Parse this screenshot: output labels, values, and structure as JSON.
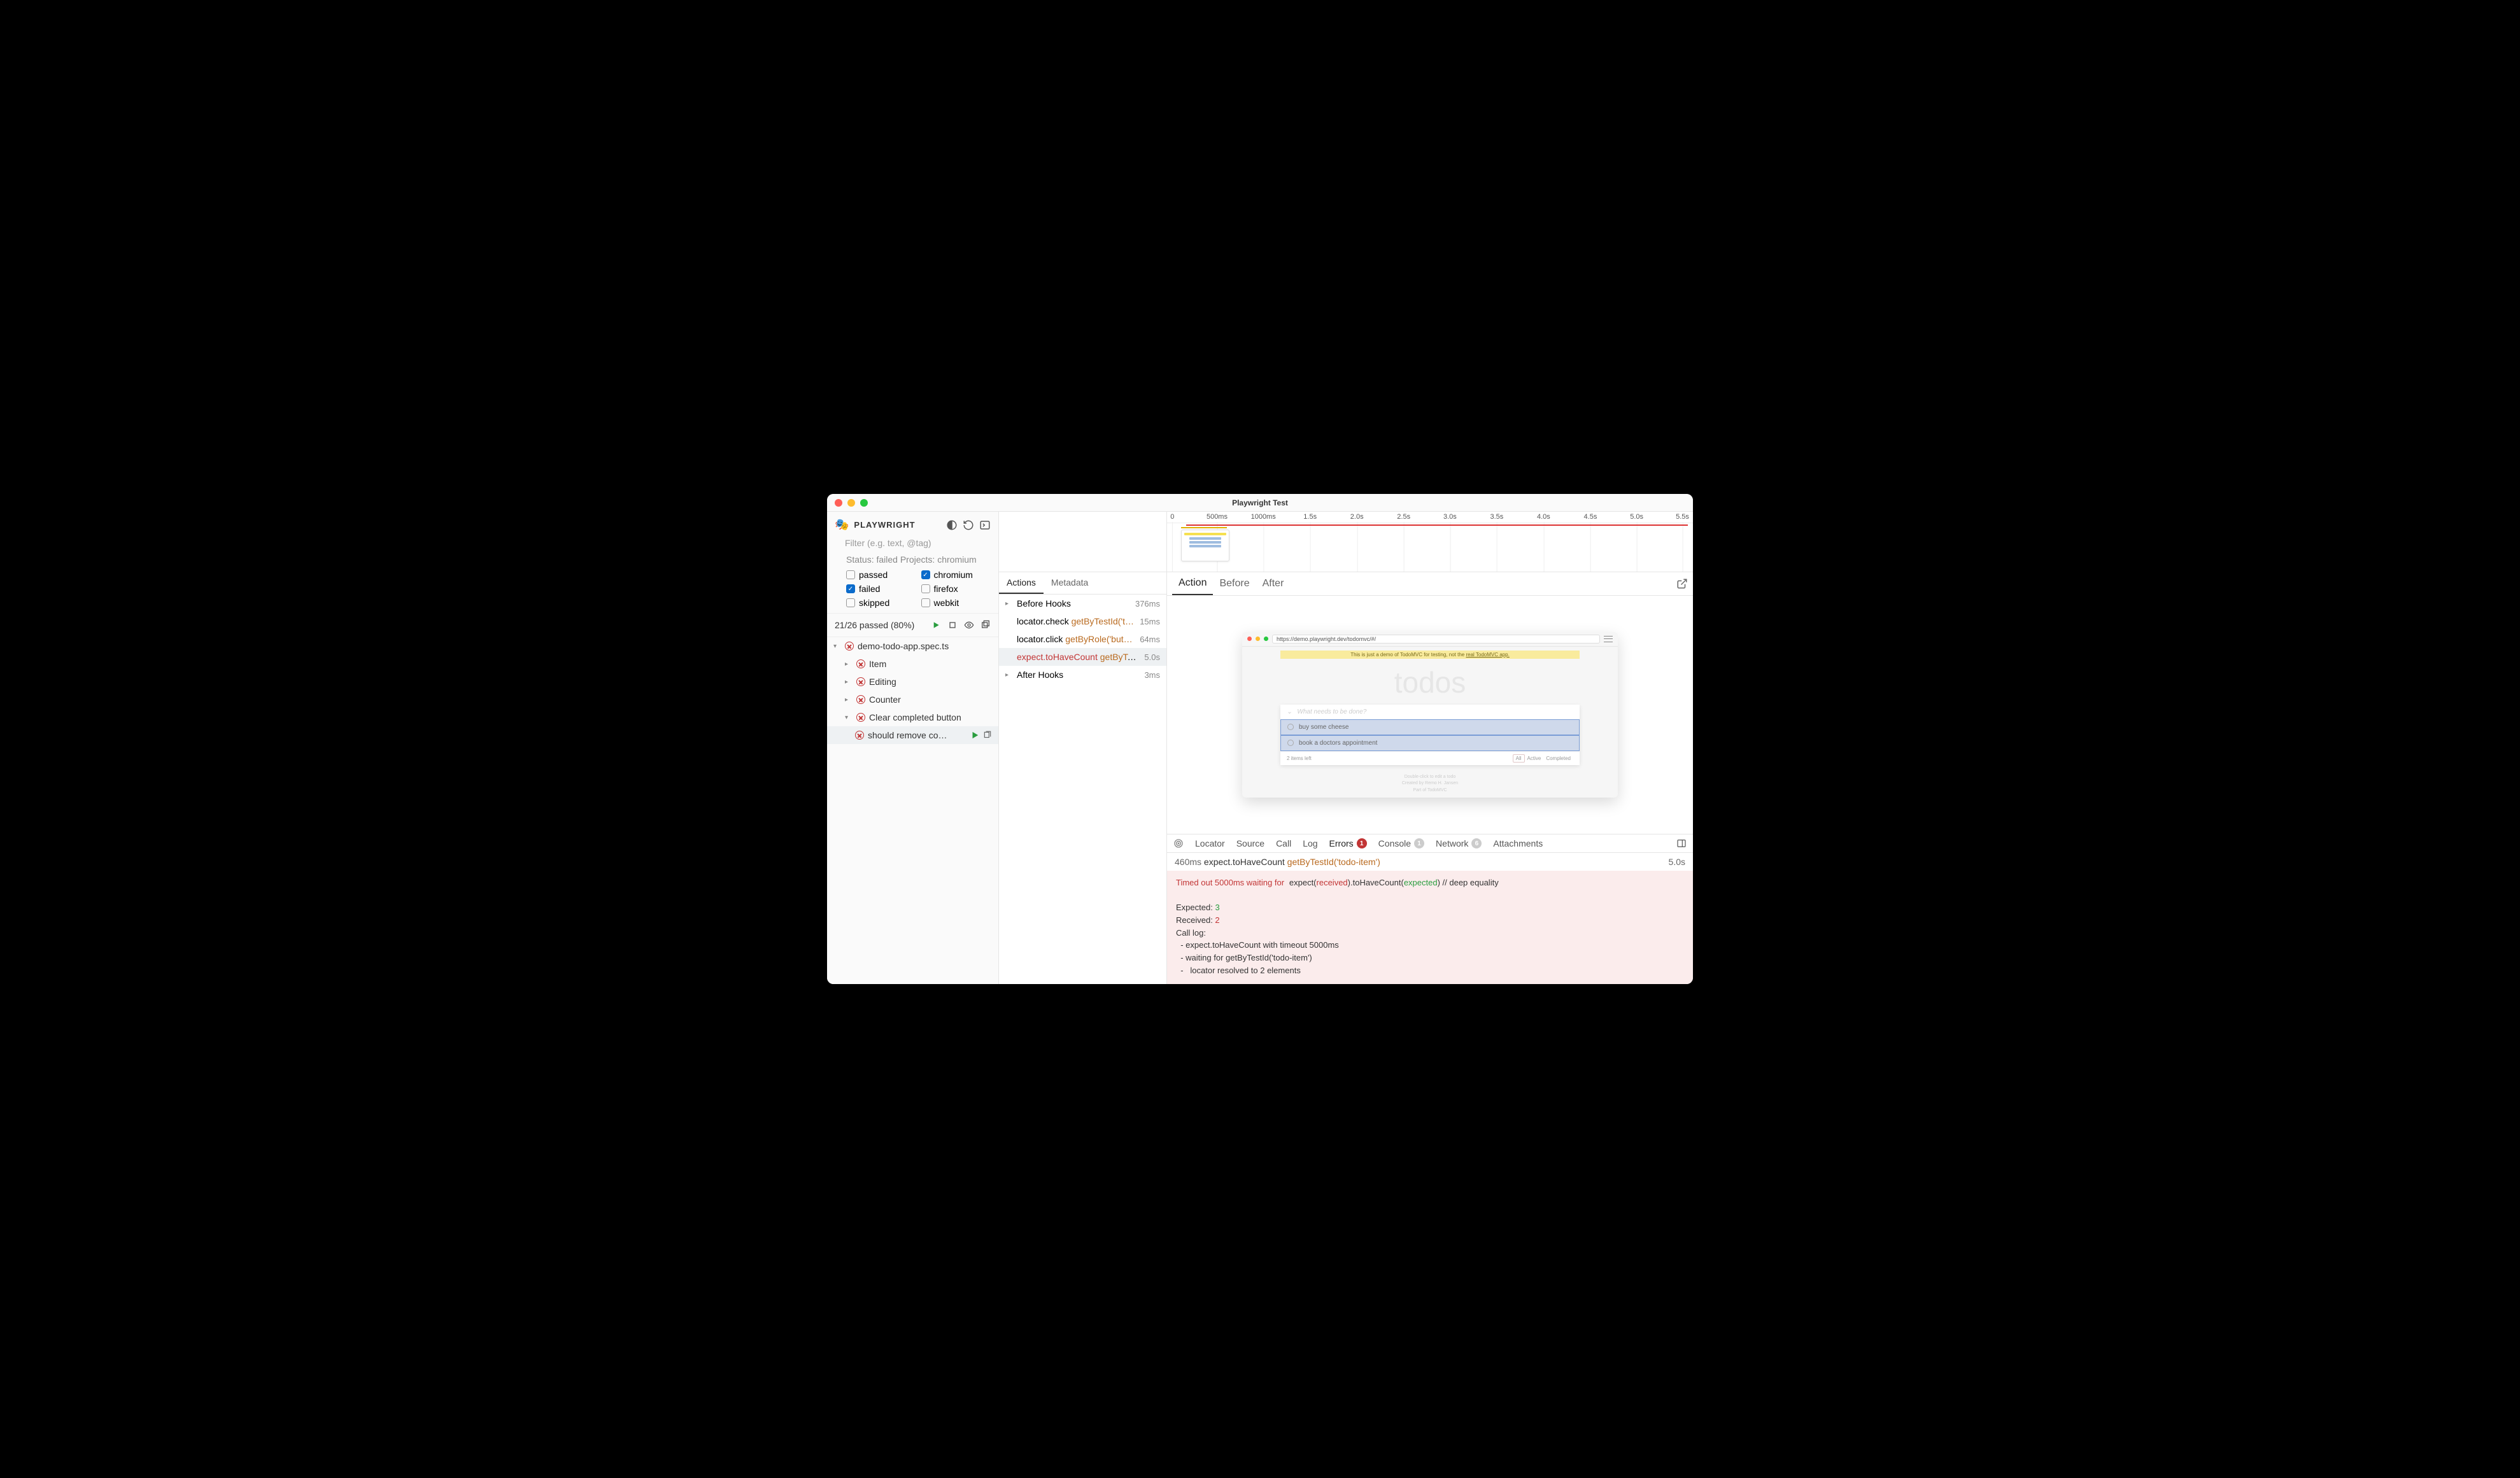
{
  "window": {
    "title": "Playwright Test"
  },
  "sidebar": {
    "brand": "PLAYWRIGHT",
    "filter_placeholder": "Filter (e.g. text, @tag)",
    "status_label": "Status:",
    "status_value": "failed",
    "projects_label": "Projects:",
    "projects_value": "chromium",
    "checkboxes": {
      "passed": {
        "label": "passed",
        "checked": false
      },
      "chromium": {
        "label": "chromium",
        "checked": true
      },
      "failed": {
        "label": "failed",
        "checked": true
      },
      "firefox": {
        "label": "firefox",
        "checked": false
      },
      "skipped": {
        "label": "skipped",
        "checked": false
      },
      "webkit": {
        "label": "webkit",
        "checked": false
      }
    },
    "summary": "21/26 passed (80%)",
    "tree": [
      {
        "label": "demo-todo-app.spec.ts",
        "indent": 0,
        "expanded": true
      },
      {
        "label": "Item",
        "indent": 1,
        "expanded": false
      },
      {
        "label": "Editing",
        "indent": 1,
        "expanded": false
      },
      {
        "label": "Counter",
        "indent": 1,
        "expanded": false
      },
      {
        "label": "Clear completed button",
        "indent": 1,
        "expanded": true
      },
      {
        "label": "should remove co…",
        "indent": 2,
        "selected": true,
        "runnable": true
      }
    ]
  },
  "mid": {
    "tabs": [
      "Actions",
      "Metadata"
    ],
    "actions": [
      {
        "chev": true,
        "label": "Before Hooks",
        "dur": "376ms"
      },
      {
        "label_a": "locator.check",
        "label_b": "getByTestId('t…",
        "dur": "15ms"
      },
      {
        "label_a": "locator.click",
        "label_b": "getByRole('but…",
        "dur": "64ms"
      },
      {
        "label_a": "expect.toHaveCount",
        "label_b": "getByTe…",
        "dur": "5.0s",
        "error": true,
        "selected": true
      },
      {
        "chev": true,
        "label": "After Hooks",
        "dur": "3ms"
      }
    ]
  },
  "timeline": {
    "ticks": [
      "0",
      "500ms",
      "1000ms",
      "1.5s",
      "2.0s",
      "2.5s",
      "3.0s",
      "3.5s",
      "4.0s",
      "4.5s",
      "5.0s",
      "5.5s"
    ]
  },
  "view_tabs": [
    "Action",
    "Before",
    "After"
  ],
  "preview": {
    "url": "https://demo.playwright.dev/todomvc/#/",
    "banner_prefix": "This is just a demo of TodoMVC for testing, not the ",
    "banner_link": "real TodoMVC app.",
    "title": "todos",
    "input_placeholder": "What needs to be done?",
    "items": [
      "buy some cheese",
      "book a doctors appointment"
    ],
    "items_left": "2 items left",
    "filters": [
      "All",
      "Active",
      "Completed"
    ],
    "credit1": "Double-click to edit a todo",
    "credit2": "Created by Remo H. Jansen",
    "credit3": "Part of TodoMVC"
  },
  "bottom": {
    "tabs": {
      "locator": "Locator",
      "source": "Source",
      "call": "Call",
      "log": "Log",
      "errors": {
        "label": "Errors",
        "count": "1"
      },
      "console": {
        "label": "Console",
        "count": "1"
      },
      "network": {
        "label": "Network",
        "count": "6"
      },
      "attachments": "Attachments"
    },
    "err_head_time": "460ms",
    "err_head_action": "expect.toHaveCount",
    "err_head_locator": "getByTestId('todo-item')",
    "err_head_dur": "5.0s",
    "error": {
      "line1a": "Timed out 5000ms waiting for",
      "line1b": "expect(",
      "line1c": "received",
      "line1d": ").toHaveCount(",
      "line1e": "expected",
      "line1f": ") // deep equality",
      "expected_label": "Expected: ",
      "expected_value": "3",
      "received_label": "Received: ",
      "received_value": "2",
      "call_log": "Call log:",
      "log1": "  - expect.toHaveCount with timeout 5000ms",
      "log2": "  - waiting for getByTestId('todo-item')",
      "log3": "  -   locator resolved to 2 elements"
    }
  }
}
